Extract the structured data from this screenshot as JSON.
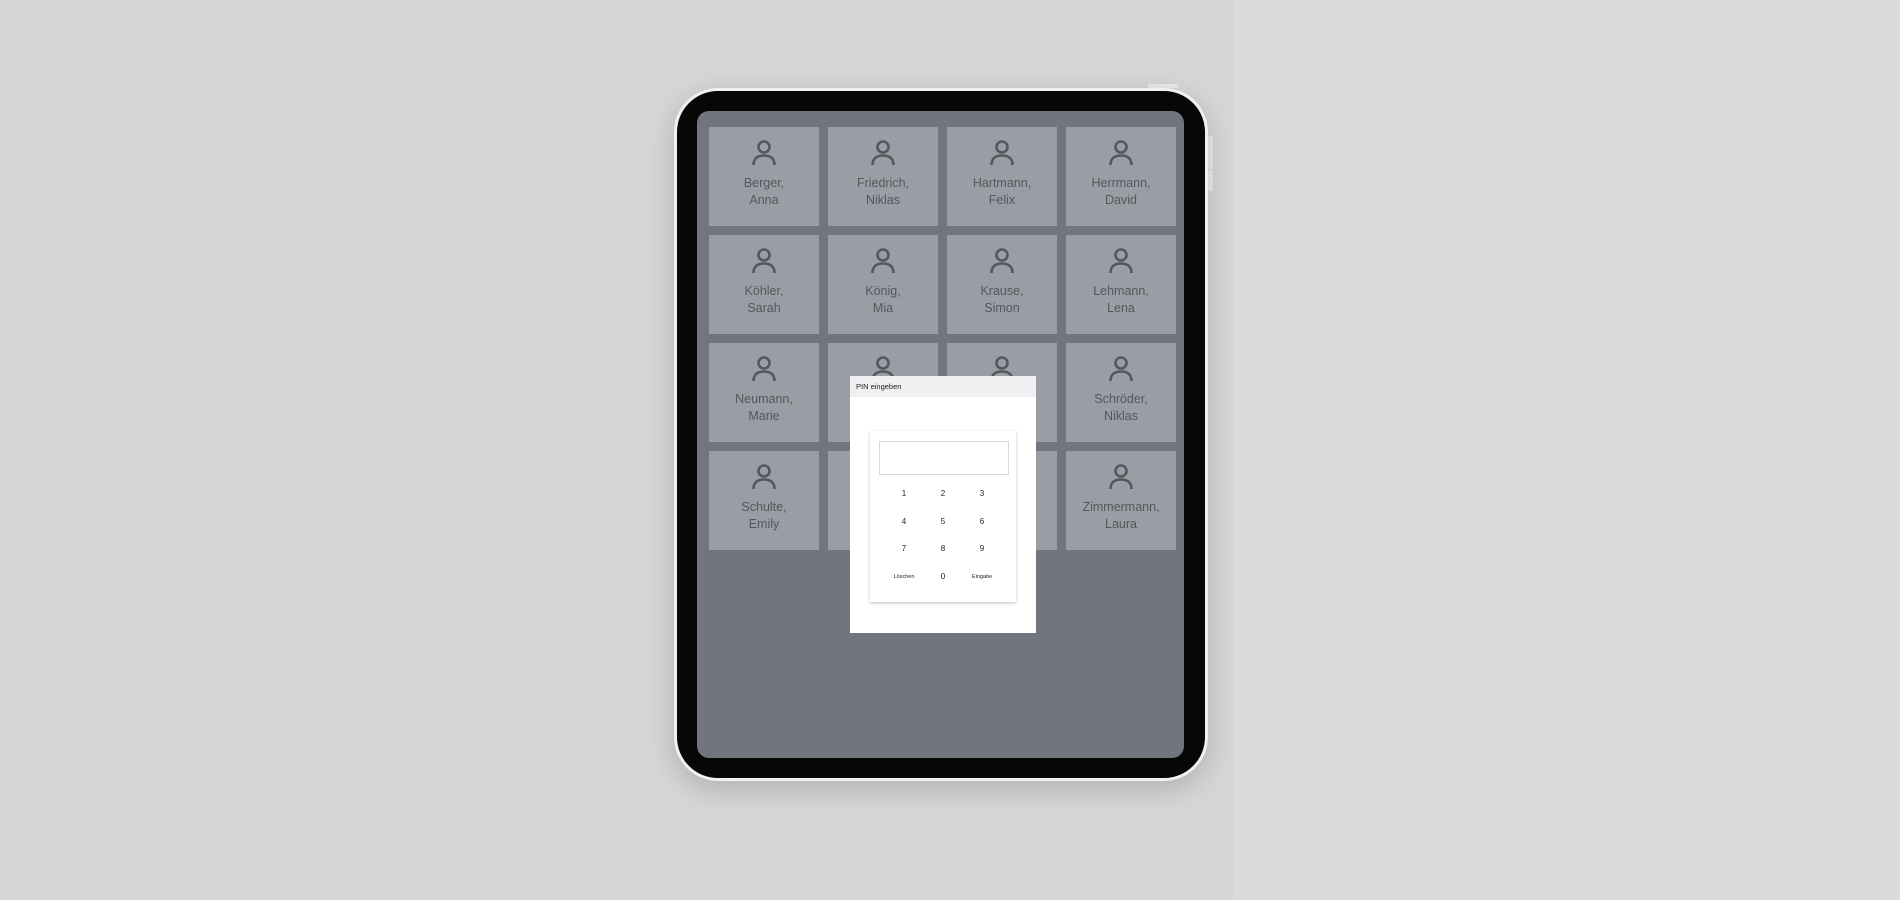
{
  "employees": [
    {
      "last": "Berger,",
      "first": "Anna"
    },
    {
      "last": "Friedrich,",
      "first": "Niklas"
    },
    {
      "last": "Hartmann,",
      "first": "Felix"
    },
    {
      "last": "Herrmann,",
      "first": "David"
    },
    {
      "last": "Köhler,",
      "first": "Sarah"
    },
    {
      "last": "König,",
      "first": "Mia"
    },
    {
      "last": "Krause,",
      "first": "Simon"
    },
    {
      "last": "Lehmann,",
      "first": "Lena"
    },
    {
      "last": "Neumann,",
      "first": "Marie"
    },
    {
      "last": "",
      "first": ""
    },
    {
      "last": "",
      "first": ""
    },
    {
      "last": "Schröder,",
      "first": "Niklas"
    },
    {
      "last": "Schulte,",
      "first": "Emily"
    },
    {
      "last": "",
      "first": ""
    },
    {
      "last": "",
      "first": ""
    },
    {
      "last": "Zimmermann,",
      "first": "Laura"
    }
  ],
  "pin_dialog": {
    "title": "PIN eingeben",
    "pin_value": "",
    "keys": [
      "1",
      "2",
      "3",
      "4",
      "5",
      "6",
      "7",
      "8",
      "9"
    ],
    "clear_label": "Löschen",
    "zero_label": "0",
    "enter_label": "Eingabe"
  },
  "icons": {
    "employee": "user-icon"
  },
  "colors": {
    "screen_bg": "#71757d",
    "tile_bg": "#9a9da3",
    "tile_text": "#54575d"
  }
}
